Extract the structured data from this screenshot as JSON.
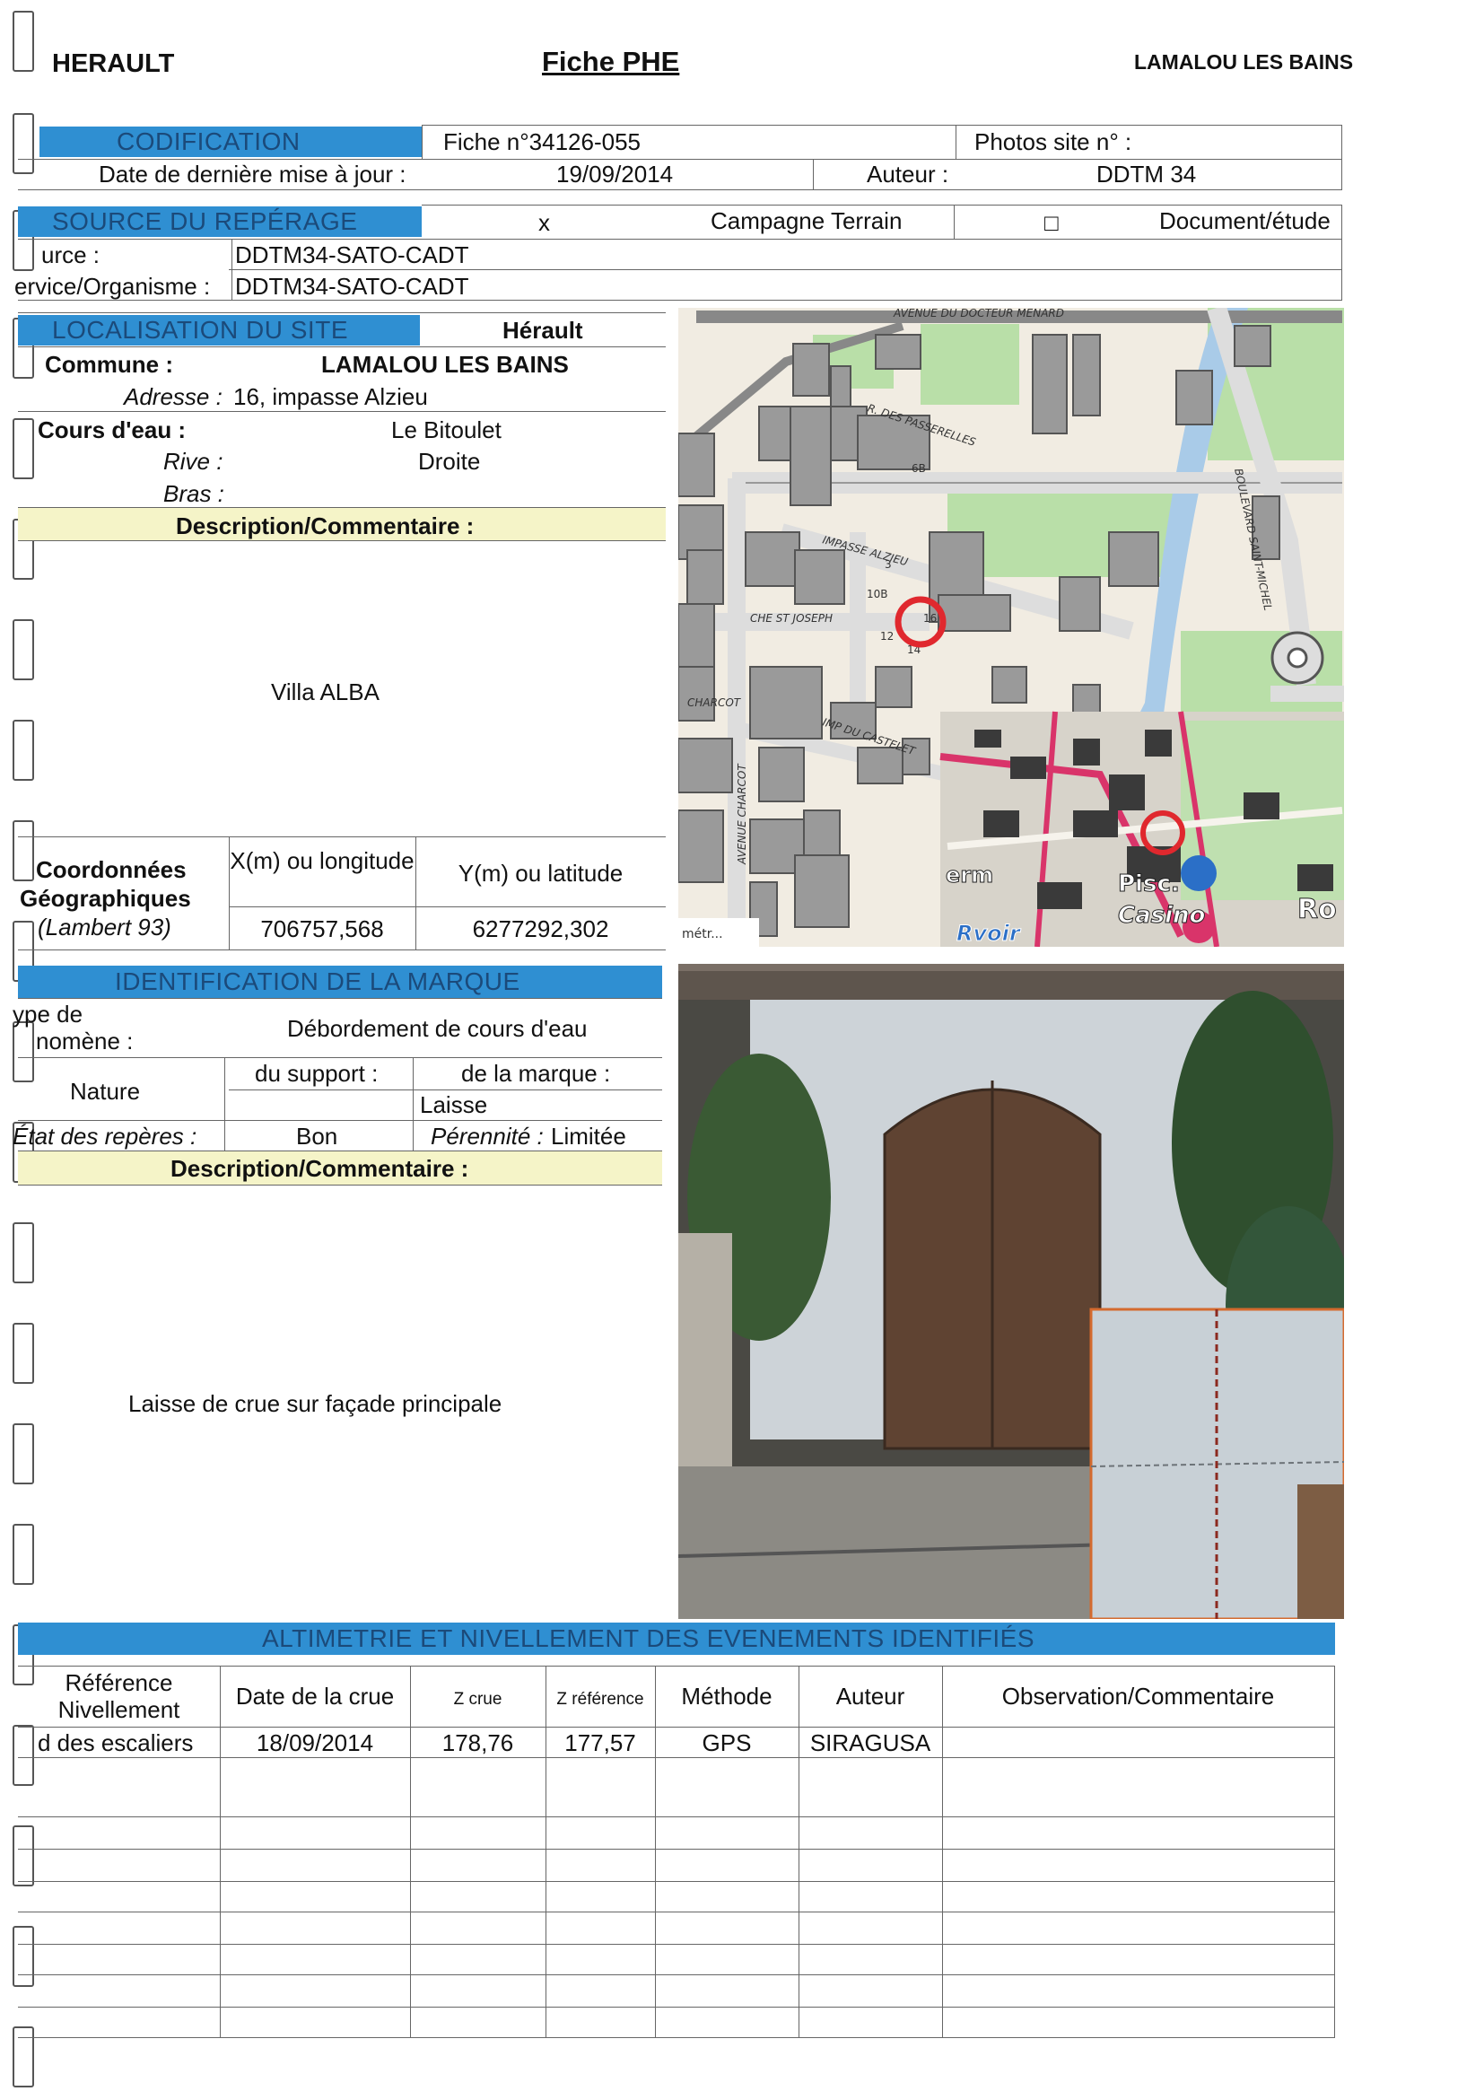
{
  "header": {
    "department": "HERAULT",
    "title": "Fiche PHE",
    "commune": "LAMALOU LES BAINS"
  },
  "codification": {
    "band": "CODIFICATION",
    "fiche": "Fiche n°34126-055",
    "photos": "Photos site n° :",
    "date_label": "Date de dernière mise à jour :",
    "date": "19/09/2014",
    "auteur_label": "Auteur :",
    "auteur": "DDTM 34"
  },
  "source": {
    "band": "SOURCE DU REPÉRAGE",
    "mark_terrain": "x",
    "terrain": "Campagne Terrain",
    "mark_doc": "□",
    "document": "Document/étude",
    "source_label": "urce :",
    "source_value": "DDTM34-SATO-CADT",
    "service_label": "ervice/Organisme :",
    "service_value": "DDTM34-SATO-CADT"
  },
  "localisation": {
    "band": "LOCALISATION DU SITE",
    "departement": "Hérault",
    "commune_label": "Commune :",
    "commune": "LAMALOU LES BAINS",
    "adresse_label": "Adresse :",
    "adresse": "16, impasse Alzieu",
    "cours_label": "Cours d'eau :",
    "cours": "Le Bitoulet",
    "rive_label": "Rive :",
    "rive": "Droite",
    "bras_label": "Bras :",
    "desc_header": "Description/Commentaire :",
    "description": "Villa ALBA"
  },
  "coordinates": {
    "label1": "Coordonnées",
    "label2": "Géographiques",
    "label3": "(Lambert 93)",
    "x_header": "X(m) ou longitude",
    "y_header": "Y(m) ou latitude",
    "x_value": "706757,568",
    "y_value": "6277292,302"
  },
  "map": {
    "street1": "AVENUE DU DOCTEUR MENARD",
    "street2": "R. DES PASSERELLES",
    "street3": "IMPASSE ALZIEU",
    "street4": "CHE ST JOSEPH",
    "street5": "CHARCOT",
    "street6": "IMP DU CASTELET",
    "street7": "AVENUE CHARCOT",
    "street8": "BOULEVARD SAINT-MICHEL",
    "num_68": "6B",
    "num_108": "10B",
    "num_16": "16",
    "num_14": "14",
    "num_12": "12",
    "num_3": "3",
    "inset_therm": "erm",
    "inset_pisc": "Pisc.",
    "inset_casino": "Casino",
    "inset_rvoir": "Rvoir",
    "inset_ro": "Ro",
    "scale_label": "métr..."
  },
  "marque": {
    "band": "IDENTIFICATION DE LA MARQUE",
    "type_label1": "ype de",
    "type_label2": "nomène :",
    "type_value": "Débordement de cours d'eau",
    "nature_label": "Nature",
    "support_label": "du support :",
    "marque_label": "de la marque :",
    "marque_value": "Laisse",
    "etat_label": "État des repères :",
    "etat_value": "Bon",
    "perennite_label": "Pérennité :",
    "perennite_value": "Limitée",
    "desc_header": "Description/Commentaire :",
    "description": "Laisse de crue sur façade principale"
  },
  "altimetrie": {
    "band": "ALTIMETRIE ET NIVELLEMENT DES EVENEMENTS IDENTIFIÉS",
    "headers": {
      "ref1": "Référence",
      "ref2": "Nivellement",
      "date": "Date de la crue",
      "zcrue": "Z crue",
      "zref": "Z référence",
      "methode": "Méthode",
      "auteur": "Auteur",
      "obs": "Observation/Commentaire"
    },
    "row1": {
      "ref": "d des escaliers",
      "date": "18/09/2014",
      "zcrue": "178,76",
      "zref": "177,57",
      "methode": "GPS",
      "auteur": "SIRAGUSA",
      "obs": ""
    }
  },
  "colors": {
    "band_blue": "#2f8fd2",
    "band_text": "#1b4a7a",
    "comment_yellow": "#f5f4c8",
    "marker_red": "#e0282e"
  }
}
